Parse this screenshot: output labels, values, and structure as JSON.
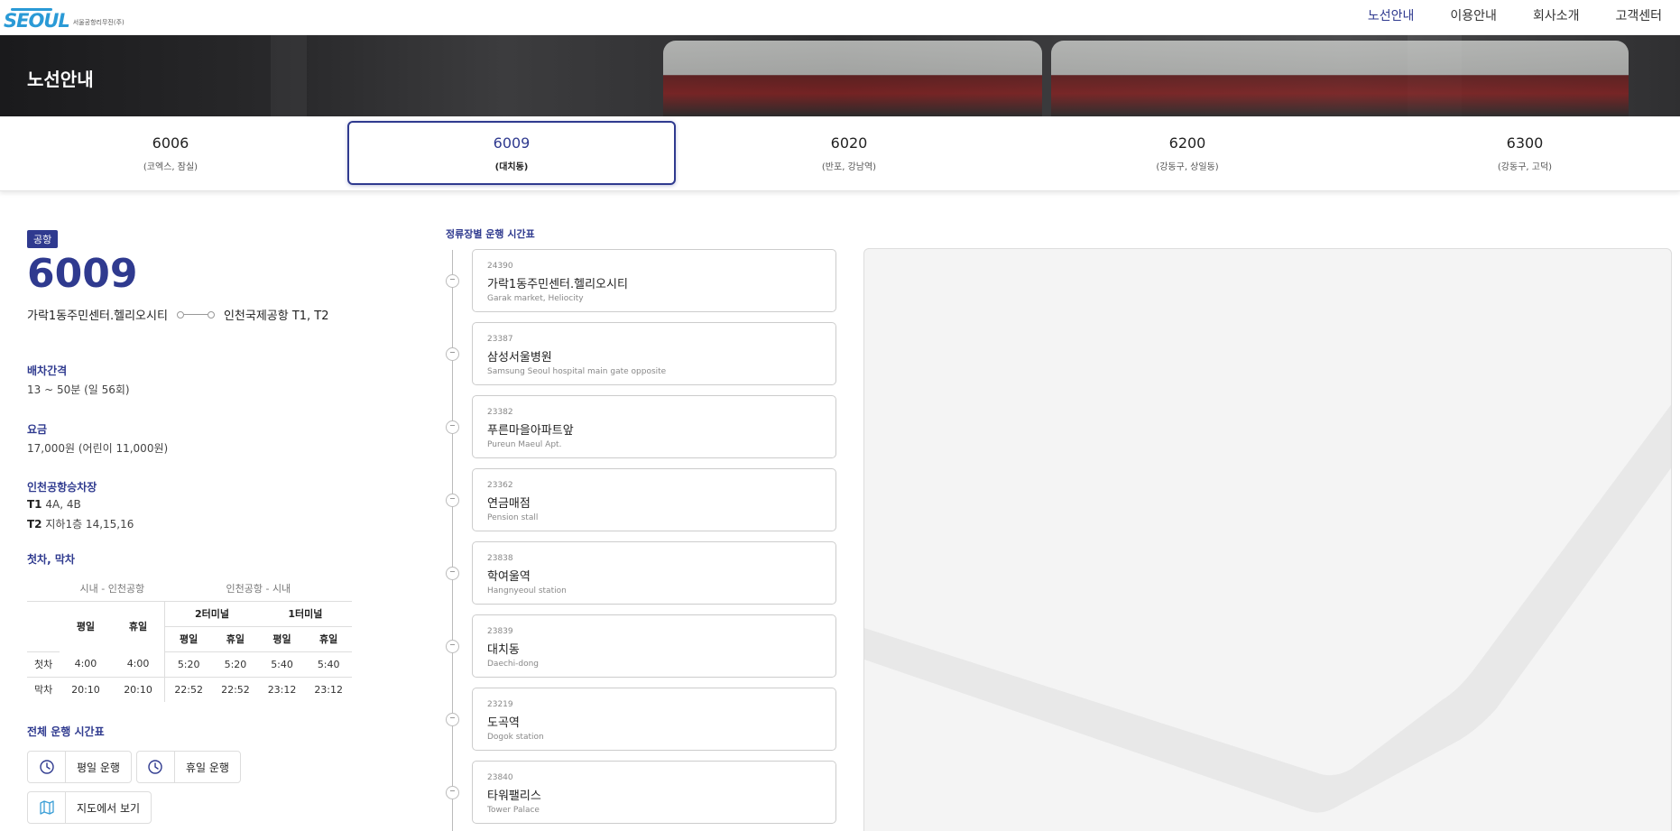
{
  "header": {
    "logo_text": "SEOUL",
    "logo_sub": "서울공항리무진(주)",
    "nav": [
      "노선안내",
      "이용안내",
      "회사소개",
      "고객센터"
    ]
  },
  "hero": {
    "title": "노선안내"
  },
  "tabs": [
    {
      "num": "6006",
      "sub": "(코엑스, 잠실)"
    },
    {
      "num": "6009",
      "sub": "(대치동)"
    },
    {
      "num": "6020",
      "sub": "(반포, 강남역)"
    },
    {
      "num": "6200",
      "sub": "(강동구, 상일동)"
    },
    {
      "num": "6300",
      "sub": "(강동구, 고덕)"
    }
  ],
  "route": {
    "badge": "공항",
    "number": "6009",
    "from": "가락1동주민센터.헬리오시티",
    "to": "인천국제공항 T1, T2",
    "interval_label": "배차간격",
    "interval_value": "13 ~ 50분 (일 56회)",
    "fare_label": "요금",
    "fare_value": "17,000원 (어린이 11,000원)",
    "boarding_label": "인천공항승차장",
    "t1_label": "T1",
    "t1_value": " 4A, 4B",
    "t2_label": "T2",
    "t2_value": " 지하1층 14,15,16",
    "times_label": "첫차, 막차",
    "full_label": "전체 운행 시간표"
  },
  "timetable": {
    "group_city": "시내 - 인천공항",
    "group_airport": "인천공항 - 시내",
    "t2": "2터미널",
    "t1": "1터미널",
    "weekday": "평일",
    "holiday": "휴일",
    "rows": [
      {
        "label": "첫차",
        "values": [
          "4:00",
          "4:00",
          "5:20",
          "5:20",
          "5:40",
          "5:40"
        ]
      },
      {
        "label": "막차",
        "values": [
          "20:10",
          "20:10",
          "22:52",
          "22:52",
          "23:12",
          "23:12"
        ]
      }
    ]
  },
  "buttons": {
    "weekday": "평일 운행",
    "holiday": "휴일 운행",
    "map": "지도에서 보기"
  },
  "stops_title": "정류장별 운행 시간표",
  "stops": [
    {
      "id": "24390",
      "kn": "가락1동주민센터.헬리오시티",
      "en": "Garak market, Heliocity"
    },
    {
      "id": "23387",
      "kn": "삼성서울병원",
      "en": "Samsung Seoul hospital main gate opposite"
    },
    {
      "id": "23382",
      "kn": "푸른마을아파트앞",
      "en": "Pureun Maeul Apt."
    },
    {
      "id": "23362",
      "kn": "연금매점",
      "en": "Pension stall"
    },
    {
      "id": "23838",
      "kn": "학여울역",
      "en": "Hangnyeoul station"
    },
    {
      "id": "23839",
      "kn": "대치동",
      "en": "Daechi-dong"
    },
    {
      "id": "23219",
      "kn": "도곡역",
      "en": "Dogok station"
    },
    {
      "id": "23840",
      "kn": "타워팰리스",
      "en": "Tower Palace"
    }
  ],
  "colors": {
    "accent": "#2f3a8f",
    "logo": "#2a9ad6"
  },
  "icons": {
    "clock": "clock-icon",
    "map": "map-icon"
  }
}
